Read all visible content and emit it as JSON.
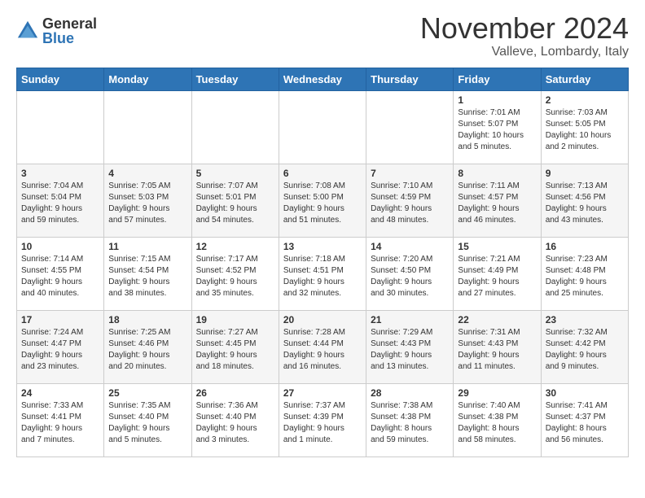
{
  "logo": {
    "general": "General",
    "blue": "Blue"
  },
  "header": {
    "month": "November 2024",
    "location": "Valleve, Lombardy, Italy"
  },
  "weekdays": [
    "Sunday",
    "Monday",
    "Tuesday",
    "Wednesday",
    "Thursday",
    "Friday",
    "Saturday"
  ],
  "weeks": [
    [
      {
        "day": "",
        "info": ""
      },
      {
        "day": "",
        "info": ""
      },
      {
        "day": "",
        "info": ""
      },
      {
        "day": "",
        "info": ""
      },
      {
        "day": "",
        "info": ""
      },
      {
        "day": "1",
        "info": "Sunrise: 7:01 AM\nSunset: 5:07 PM\nDaylight: 10 hours\nand 5 minutes."
      },
      {
        "day": "2",
        "info": "Sunrise: 7:03 AM\nSunset: 5:05 PM\nDaylight: 10 hours\nand 2 minutes."
      }
    ],
    [
      {
        "day": "3",
        "info": "Sunrise: 7:04 AM\nSunset: 5:04 PM\nDaylight: 9 hours\nand 59 minutes."
      },
      {
        "day": "4",
        "info": "Sunrise: 7:05 AM\nSunset: 5:03 PM\nDaylight: 9 hours\nand 57 minutes."
      },
      {
        "day": "5",
        "info": "Sunrise: 7:07 AM\nSunset: 5:01 PM\nDaylight: 9 hours\nand 54 minutes."
      },
      {
        "day": "6",
        "info": "Sunrise: 7:08 AM\nSunset: 5:00 PM\nDaylight: 9 hours\nand 51 minutes."
      },
      {
        "day": "7",
        "info": "Sunrise: 7:10 AM\nSunset: 4:59 PM\nDaylight: 9 hours\nand 48 minutes."
      },
      {
        "day": "8",
        "info": "Sunrise: 7:11 AM\nSunset: 4:57 PM\nDaylight: 9 hours\nand 46 minutes."
      },
      {
        "day": "9",
        "info": "Sunrise: 7:13 AM\nSunset: 4:56 PM\nDaylight: 9 hours\nand 43 minutes."
      }
    ],
    [
      {
        "day": "10",
        "info": "Sunrise: 7:14 AM\nSunset: 4:55 PM\nDaylight: 9 hours\nand 40 minutes."
      },
      {
        "day": "11",
        "info": "Sunrise: 7:15 AM\nSunset: 4:54 PM\nDaylight: 9 hours\nand 38 minutes."
      },
      {
        "day": "12",
        "info": "Sunrise: 7:17 AM\nSunset: 4:52 PM\nDaylight: 9 hours\nand 35 minutes."
      },
      {
        "day": "13",
        "info": "Sunrise: 7:18 AM\nSunset: 4:51 PM\nDaylight: 9 hours\nand 32 minutes."
      },
      {
        "day": "14",
        "info": "Sunrise: 7:20 AM\nSunset: 4:50 PM\nDaylight: 9 hours\nand 30 minutes."
      },
      {
        "day": "15",
        "info": "Sunrise: 7:21 AM\nSunset: 4:49 PM\nDaylight: 9 hours\nand 27 minutes."
      },
      {
        "day": "16",
        "info": "Sunrise: 7:23 AM\nSunset: 4:48 PM\nDaylight: 9 hours\nand 25 minutes."
      }
    ],
    [
      {
        "day": "17",
        "info": "Sunrise: 7:24 AM\nSunset: 4:47 PM\nDaylight: 9 hours\nand 23 minutes."
      },
      {
        "day": "18",
        "info": "Sunrise: 7:25 AM\nSunset: 4:46 PM\nDaylight: 9 hours\nand 20 minutes."
      },
      {
        "day": "19",
        "info": "Sunrise: 7:27 AM\nSunset: 4:45 PM\nDaylight: 9 hours\nand 18 minutes."
      },
      {
        "day": "20",
        "info": "Sunrise: 7:28 AM\nSunset: 4:44 PM\nDaylight: 9 hours\nand 16 minutes."
      },
      {
        "day": "21",
        "info": "Sunrise: 7:29 AM\nSunset: 4:43 PM\nDaylight: 9 hours\nand 13 minutes."
      },
      {
        "day": "22",
        "info": "Sunrise: 7:31 AM\nSunset: 4:43 PM\nDaylight: 9 hours\nand 11 minutes."
      },
      {
        "day": "23",
        "info": "Sunrise: 7:32 AM\nSunset: 4:42 PM\nDaylight: 9 hours\nand 9 minutes."
      }
    ],
    [
      {
        "day": "24",
        "info": "Sunrise: 7:33 AM\nSunset: 4:41 PM\nDaylight: 9 hours\nand 7 minutes."
      },
      {
        "day": "25",
        "info": "Sunrise: 7:35 AM\nSunset: 4:40 PM\nDaylight: 9 hours\nand 5 minutes."
      },
      {
        "day": "26",
        "info": "Sunrise: 7:36 AM\nSunset: 4:40 PM\nDaylight: 9 hours\nand 3 minutes."
      },
      {
        "day": "27",
        "info": "Sunrise: 7:37 AM\nSunset: 4:39 PM\nDaylight: 9 hours\nand 1 minute."
      },
      {
        "day": "28",
        "info": "Sunrise: 7:38 AM\nSunset: 4:38 PM\nDaylight: 8 hours\nand 59 minutes."
      },
      {
        "day": "29",
        "info": "Sunrise: 7:40 AM\nSunset: 4:38 PM\nDaylight: 8 hours\nand 58 minutes."
      },
      {
        "day": "30",
        "info": "Sunrise: 7:41 AM\nSunset: 4:37 PM\nDaylight: 8 hours\nand 56 minutes."
      }
    ]
  ]
}
